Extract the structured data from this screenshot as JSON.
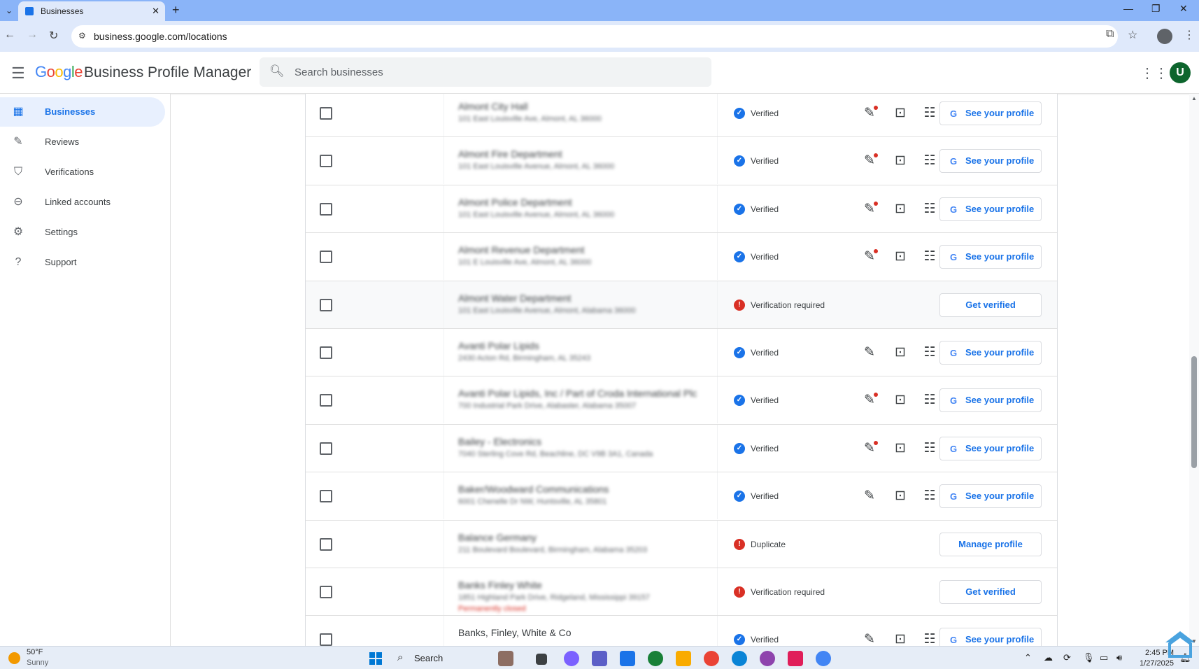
{
  "browser": {
    "tab_title": "Businesses",
    "url": "business.google.com/locations"
  },
  "header": {
    "logo_letters": [
      "G",
      "o",
      "o",
      "g",
      "l",
      "e"
    ],
    "product_name": "Business Profile Manager",
    "search_placeholder": "Search businesses",
    "avatar_letter": "U"
  },
  "sidebar": {
    "items": [
      {
        "label": "Businesses",
        "icon": "store-icon",
        "active": true
      },
      {
        "label": "Reviews",
        "icon": "reviews-icon",
        "active": false
      },
      {
        "label": "Verifications",
        "icon": "shield-check-icon",
        "active": false
      },
      {
        "label": "Linked accounts",
        "icon": "link-icon",
        "active": false
      },
      {
        "label": "Settings",
        "icon": "gear-icon",
        "active": false
      },
      {
        "label": "Support",
        "icon": "help-icon",
        "active": false
      }
    ]
  },
  "listings": [
    {
      "name": "Almont City Hall",
      "address": "101 East Louisville Ave, Almont, AL 36000",
      "note": "",
      "status": "Verified",
      "verified": true,
      "has_actions": true,
      "edit_dot": true,
      "button": "See your profile"
    },
    {
      "name": "Almont Fire Department",
      "address": "101 East Louisville Avenue, Almont, AL 36000",
      "note": "",
      "status": "Verified",
      "verified": true,
      "has_actions": true,
      "edit_dot": true,
      "button": "See your profile"
    },
    {
      "name": "Almont Police Department",
      "address": "101 East Louisville Avenue, Almont, AL 36000",
      "note": "",
      "status": "Verified",
      "verified": true,
      "has_actions": true,
      "edit_dot": true,
      "button": "See your profile"
    },
    {
      "name": "Almont Revenue Department",
      "address": "101 E Louisville Ave, Almont, AL 36000",
      "note": "",
      "status": "Verified",
      "verified": true,
      "has_actions": true,
      "edit_dot": true,
      "button": "See your profile"
    },
    {
      "name": "Almont Water Department",
      "address": "101 East Louisville Avenue, Almont, Alabama 36000",
      "note": "",
      "status": "Verification required",
      "verified": false,
      "has_actions": false,
      "edit_dot": false,
      "button": "Get verified"
    },
    {
      "name": "Avanti Polar Lipids",
      "address": "2430 Acton Rd, Birmingham, AL 35243",
      "note": "",
      "status": "Verified",
      "verified": true,
      "has_actions": true,
      "edit_dot": false,
      "button": "See your profile"
    },
    {
      "name": "Avanti Polar Lipids, Inc / Part of Croda International Plc",
      "address": "700 Industrial Park Drive, Alabaster, Alabama 35007",
      "note": "",
      "status": "Verified",
      "verified": true,
      "has_actions": true,
      "edit_dot": true,
      "button": "See your profile"
    },
    {
      "name": "Bailey - Electronics",
      "address": "7040 Sterling Cove Rd, Beachline, DC V9B 3A1, Canada",
      "note": "",
      "status": "Verified",
      "verified": true,
      "has_actions": true,
      "edit_dot": true,
      "button": "See your profile"
    },
    {
      "name": "Baker/Woodward Communications",
      "address": "6001 Chenelle Dr NW, Huntsville, AL 35801",
      "note": "",
      "status": "Verified",
      "verified": true,
      "has_actions": true,
      "edit_dot": false,
      "button": "See your profile"
    },
    {
      "name": "Balance Germany",
      "address": "211 Boulevard Boulevard, Birmingham, Alabama 35203",
      "note": "",
      "status": "Duplicate",
      "verified": false,
      "has_actions": false,
      "edit_dot": false,
      "button": "Manage profile"
    },
    {
      "name": "Banks Finley White",
      "address": "1851 Highland Park Drive, Ridgeland, Mississippi 39157",
      "note": "Permanently closed",
      "status": "Verification required",
      "verified": false,
      "has_actions": false,
      "edit_dot": false,
      "button": "Get verified"
    },
    {
      "name": "Banks, Finley, White & Co",
      "address": "",
      "note": "",
      "status": "Verified",
      "verified": true,
      "has_actions": true,
      "edit_dot": false,
      "button": "See your profile"
    }
  ],
  "taskbar": {
    "temperature": "50°F",
    "condition": "Sunny",
    "search_label": "Search",
    "time": "2:45 PM",
    "date": "1/27/2025"
  },
  "colors": {
    "accent": "#1a73e8",
    "warning": "#d93025",
    "chrome_frame": "#8ab4f8"
  }
}
